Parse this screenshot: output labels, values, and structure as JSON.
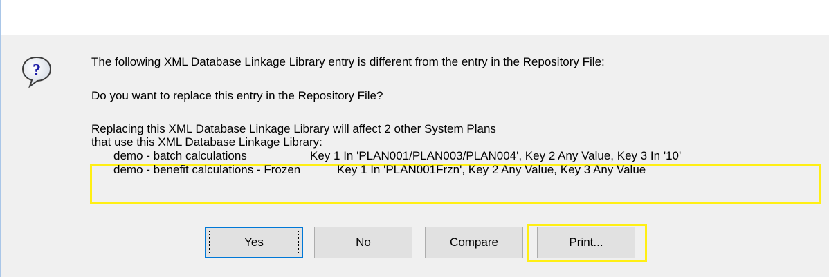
{
  "dialog": {
    "icon": "question-icon",
    "icon_glyph": "?",
    "line1": "The following XML Database Linkage Library entry is different from the entry in the Repository File:",
    "line2": "Do you want to replace this entry in the Repository File?",
    "line3": "Replacing this XML Database Linkage Library will affect 2 other System Plans",
    "line4": "that use this XML Database Linkage Library:",
    "plans": [
      {
        "name": "demo - batch calculations",
        "keys": "Key 1 In 'PLAN001/PLAN003/PLAN004', Key 2 Any Value, Key 3 In '10'"
      },
      {
        "name": "demo - benefit calculations - Frozen",
        "keys": "Key 1 In 'PLAN001Frzn', Key 2 Any Value, Key 3 Any Value"
      }
    ]
  },
  "buttons": {
    "yes": {
      "mnemonic": "Y",
      "rest": "es"
    },
    "no": {
      "mnemonic": "N",
      "rest": "o"
    },
    "compare": {
      "mnemonic": "C",
      "rest": "ompare"
    },
    "print": {
      "mnemonic": "P",
      "rest": "rint..."
    }
  },
  "colors": {
    "highlight": "#ffef14",
    "dialog_background": "#f0f0f0",
    "button_face": "#e1e1e1",
    "default_button_border": "#0078d7"
  }
}
